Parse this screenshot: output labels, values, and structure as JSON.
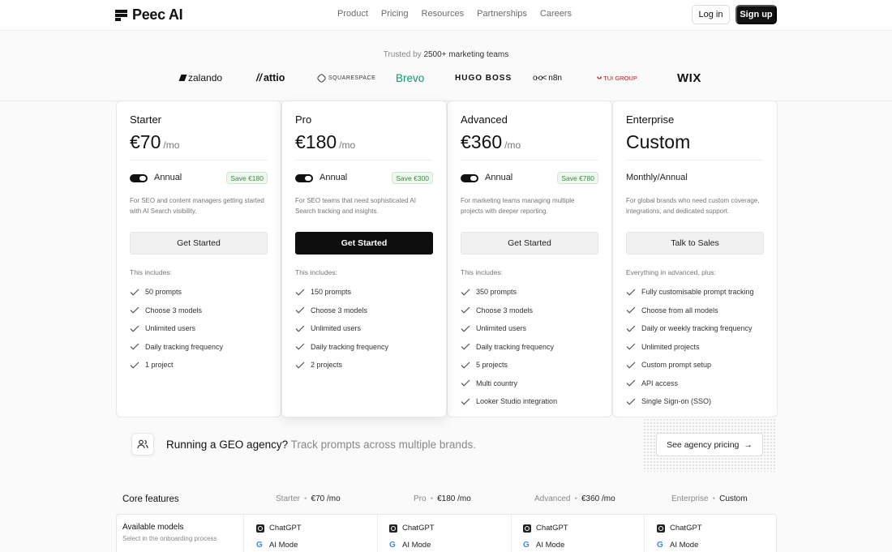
{
  "nav": {
    "logo_text": "Peec AI",
    "links": [
      "Product",
      "Pricing",
      "Resources",
      "Partnerships",
      "Careers"
    ],
    "login_label": "Log in",
    "signup_label": "Sign up"
  },
  "trusted": {
    "prefix": "Trusted by",
    "count": "2500+ marketing teams"
  },
  "brands": [
    "zalando",
    "attio",
    "SQUARESPACE",
    "Brevo",
    "HUGO BOSS",
    "n8n",
    "TUI GROUP",
    "WIX"
  ],
  "plans": [
    {
      "name": "Starter",
      "price": "€70",
      "per": "/mo",
      "billing": "Annual",
      "save": "Save €180",
      "desc": "For SEO and content managers getting started with AI Search visibility.",
      "cta": "Get Started",
      "includes": "This includes:",
      "features": [
        "50 prompts",
        "Choose 3 models",
        "Unlimited users",
        "Daily tracking frequency",
        "1 project"
      ]
    },
    {
      "name": "Pro",
      "price": "€180",
      "per": "/mo",
      "billing": "Annual",
      "save": "Save €300",
      "desc": "For SEO teams that need sophisticated AI Search tracking and insights.",
      "cta": "Get Started",
      "includes": "This includes:",
      "features": [
        "150 prompts",
        "Choose 3 models",
        "Unlimited users",
        "Daily tracking frequency",
        "2 projects"
      ]
    },
    {
      "name": "Advanced",
      "price": "€360",
      "per": "/mo",
      "billing": "Annual",
      "save": "Save €780",
      "desc": "For marketing teams managing multiple projects with deeper reporting.",
      "cta": "Get Started",
      "includes": "This includes:",
      "features": [
        "350 prompts",
        "Choose 3 models",
        "Unlimited users",
        "Daily tracking frequency",
        "5 projects",
        "Multi country",
        "Looker Studio integration"
      ]
    },
    {
      "name": "Enterprise",
      "price": "Custom",
      "per": "",
      "billing": "Monthly/Annual",
      "save": "",
      "desc": "For global brands who need custom coverage, integrations, and dedicated support.",
      "cta": "Talk to Sales",
      "includes": "Everything in advanced, plus:",
      "features": [
        "Fully customisable prompt tracking",
        "Choose from all models",
        "Daily or weekly tracking frequency",
        "Unlimited projects",
        "Custom prompt setup",
        "API access",
        "Single Sign-on (SSO)"
      ]
    }
  ],
  "agency": {
    "headline": "Running a GEO agency?",
    "sub": "Track prompts across multiple brands.",
    "button": "See agency pricing",
    "icon": "users-icon"
  },
  "core": {
    "title": "Core features",
    "columns": [
      {
        "name": "Starter",
        "price": "€70 /mo"
      },
      {
        "name": "Pro",
        "price": "€180 /mo"
      },
      {
        "name": "Advanced",
        "price": "€360 /mo"
      },
      {
        "name": "Enterprise",
        "price": "Custom"
      }
    ],
    "row_label": "Available models",
    "row_sub": "Select in the onboarding process",
    "models": [
      "ChatGPT",
      "AI Mode"
    ]
  },
  "colors": {
    "accent": "#111111",
    "save_green": "#3d8a45",
    "brevo_green": "#0b996e",
    "tui_red": "#d40e14"
  }
}
